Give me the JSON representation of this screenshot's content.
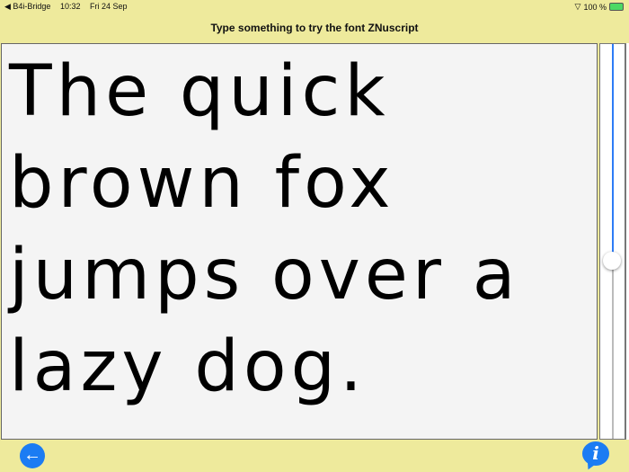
{
  "status_bar": {
    "back_app": "◀ B4i-Bridge",
    "time": "10:32",
    "date": "Fri 24 Sep",
    "battery": "100 %"
  },
  "header": {
    "title": "Type something to try the font ZNuscript"
  },
  "editor": {
    "value": "The quick brown fox jumps over a lazy dog."
  },
  "size_slider": {
    "fraction_from_top": 0.55
  },
  "footer": {
    "back_icon": "←",
    "info_icon": "i"
  },
  "colors": {
    "background": "#eeea9c",
    "accent": "#1b7cf3"
  }
}
